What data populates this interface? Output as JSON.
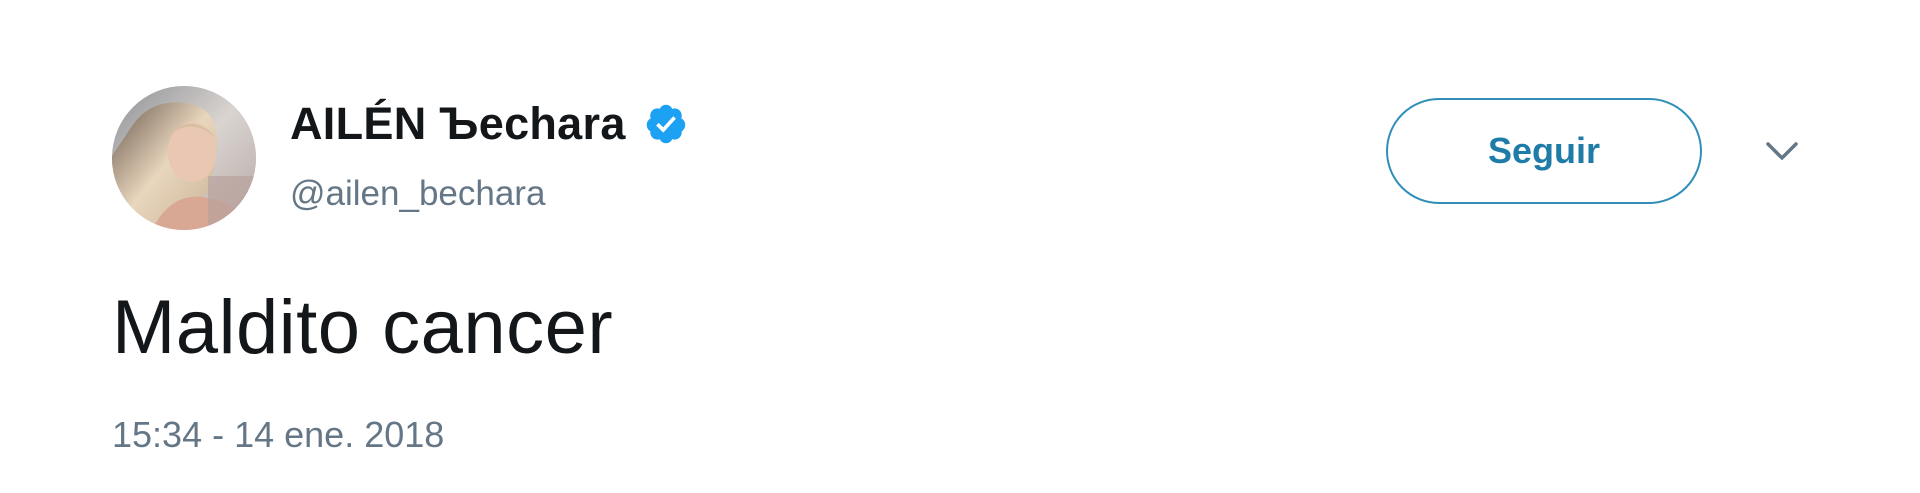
{
  "author": {
    "display_name": "AILÉN Ъechara",
    "handle": "@ailen_bechara",
    "verified": true,
    "avatar_icon": "profile-photo"
  },
  "actions": {
    "follow_label": "Seguir",
    "more_icon": "chevron-down-icon"
  },
  "tweet": {
    "text": "Maldito cancer",
    "timestamp": "15:34 - 14 ene. 2018"
  },
  "colors": {
    "accent": "#1da1f2",
    "follow_text": "#1f7ba8",
    "secondary_text": "#657786",
    "primary_text": "#14171a"
  }
}
